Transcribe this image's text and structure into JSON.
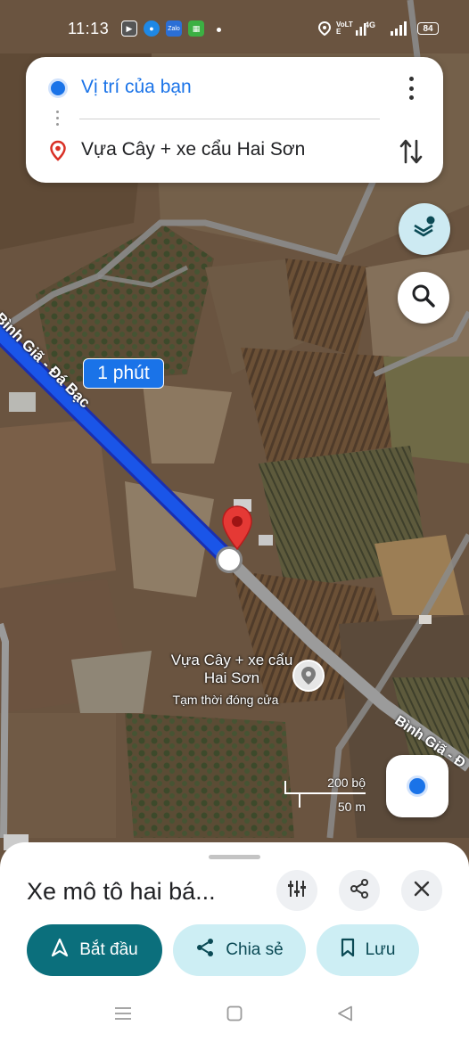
{
  "status_bar": {
    "time": "11:13",
    "network_badge": "VoLTE",
    "signal_badge": "4G",
    "battery": "84"
  },
  "directions": {
    "origin": "Vị trí của bạn",
    "destination": "Vựa Cây + xe cẩu Hai Sơn"
  },
  "map": {
    "route_time": "1 phút",
    "road_label_1": "Bình Giã - Đá Bạc",
    "road_label_2": "Bình Giã - Đ",
    "place_name": "Vựa Cây + xe cẩu Hai Sơn",
    "place_status": "Tạm thời đóng cửa",
    "scale_ft": "200 bộ",
    "scale_m": "50 m"
  },
  "sheet": {
    "title": "Xe mô tô hai bá...",
    "start_label": "Bắt đầu",
    "share_label": "Chia sẻ",
    "save_label": "Lưu"
  },
  "colors": {
    "route": "#1a55e8",
    "accent": "#0b6f7c",
    "pin": "#e53935"
  },
  "icons": [
    "more-vert-icon",
    "swap-vert-icon",
    "layers-icon",
    "search-icon",
    "my-location-icon",
    "tune-icon",
    "share-icon",
    "close-icon",
    "navigation-icon",
    "bookmark-icon"
  ]
}
